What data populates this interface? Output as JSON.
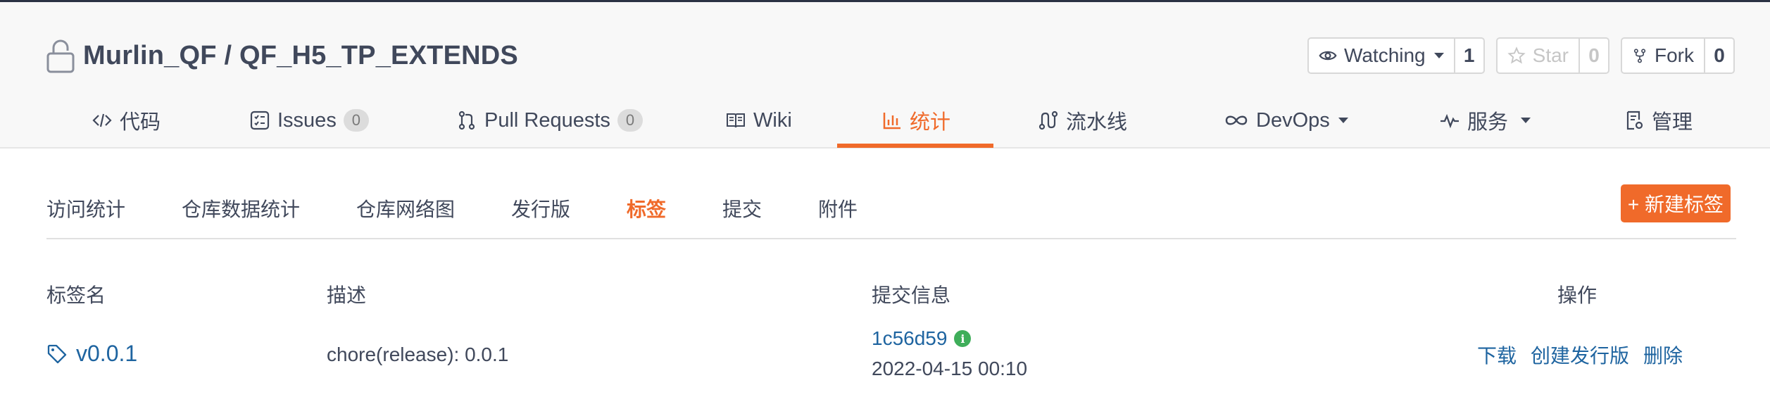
{
  "repo": {
    "title": "Murlin_QF / QF_H5_TP_EXTENDS",
    "lock_icon": "lock-icon"
  },
  "actions": {
    "watch": {
      "label": "Watching",
      "count": "1",
      "icon": "eye-icon"
    },
    "star": {
      "label": "Star",
      "count": "0",
      "icon": "star-icon"
    },
    "fork": {
      "label": "Fork",
      "count": "0",
      "icon": "fork-icon"
    }
  },
  "tabs": [
    {
      "label": "代码",
      "icon": "code-icon"
    },
    {
      "label": "Issues",
      "badge": "0",
      "icon": "issues-icon"
    },
    {
      "label": "Pull Requests",
      "badge": "0",
      "icon": "pull-request-icon"
    },
    {
      "label": "Wiki",
      "icon": "book-icon"
    },
    {
      "label": "统计",
      "icon": "bar-chart-icon",
      "active": true
    },
    {
      "label": "流水线",
      "icon": "pipeline-icon"
    },
    {
      "label": "DevOps",
      "icon": "infinity-icon"
    },
    {
      "label": "服务",
      "icon": "pulse-icon"
    },
    {
      "label": "管理",
      "icon": "settings-doc-icon"
    }
  ],
  "subnav": [
    {
      "label": "访问统计"
    },
    {
      "label": "仓库数据统计"
    },
    {
      "label": "仓库网络图"
    },
    {
      "label": "发行版"
    },
    {
      "label": "标签",
      "active": true
    },
    {
      "label": "提交"
    },
    {
      "label": "附件"
    }
  ],
  "new_tag_button": "+ 新建标签",
  "table": {
    "headers": [
      "标签名",
      "描述",
      "提交信息",
      "操作"
    ],
    "rows": [
      {
        "tag": "v0.0.1",
        "description": "chore(release): 0.0.1",
        "commit": "1c56d59",
        "date": "2022-04-15 00:10",
        "actions": [
          "下载",
          "创建发行版",
          "删除"
        ]
      }
    ]
  },
  "colors": {
    "accent": "#f06a2a",
    "link": "#1e64a0",
    "text": "#40485b",
    "header_bg": "#f8f8f8",
    "verified": "#3fae5a"
  }
}
